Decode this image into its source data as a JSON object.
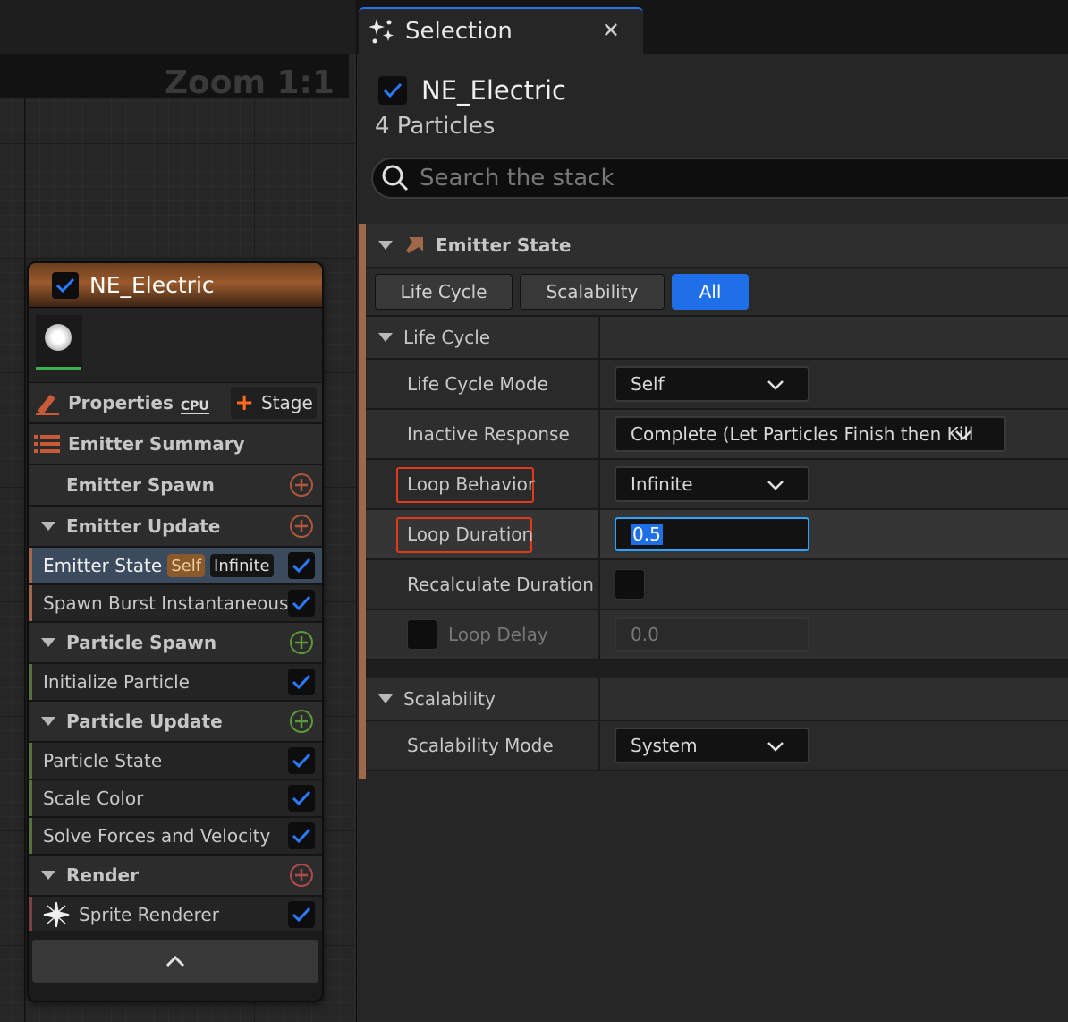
{
  "graph": {
    "zoom_label": "Zoom 1:1"
  },
  "node": {
    "title": "NE_Electric",
    "title_checked": true,
    "properties_label": "Properties",
    "cpu_badge": "CPU",
    "stage_button": "Stage",
    "rows": [
      {
        "kind": "head",
        "label": "Emitter Summary",
        "icon": "list-icon"
      },
      {
        "kind": "subhead",
        "label": "Emitter Spawn",
        "add": "orange"
      },
      {
        "kind": "group",
        "label": "Emitter Update",
        "add": "orange"
      },
      {
        "kind": "item",
        "label": "Emitter State",
        "accent": "orange",
        "selected": true,
        "pills": [
          "Self",
          "Infinite"
        ],
        "checked": true
      },
      {
        "kind": "item",
        "label": "Spawn Burst Instantaneous",
        "accent": "orange",
        "checked": true
      },
      {
        "kind": "group",
        "label": "Particle Spawn",
        "add": "green"
      },
      {
        "kind": "item",
        "label": "Initialize Particle",
        "accent": "green",
        "checked": true
      },
      {
        "kind": "group",
        "label": "Particle Update",
        "add": "green"
      },
      {
        "kind": "item",
        "label": "Particle State",
        "accent": "green",
        "checked": true
      },
      {
        "kind": "item",
        "label": "Scale Color",
        "accent": "green",
        "checked": true
      },
      {
        "kind": "item",
        "label": "Solve Forces and Velocity",
        "accent": "green",
        "checked": true
      },
      {
        "kind": "group",
        "label": "Render",
        "add": "red"
      },
      {
        "kind": "item",
        "label": "Sprite Renderer",
        "accent": "red",
        "checked": true,
        "icon": "sprite-icon"
      }
    ]
  },
  "panel": {
    "tab_title": "Selection",
    "emitter_name": "NE_Electric",
    "particles_count": "4 Particles",
    "search_placeholder": "Search the stack",
    "section_title": "Emitter State",
    "filters": [
      {
        "label": "Life Cycle",
        "active": false
      },
      {
        "label": "Scalability",
        "active": false
      },
      {
        "label": "All",
        "active": true
      }
    ],
    "lifecycle": {
      "category": "Life Cycle",
      "life_cycle_mode": {
        "label": "Life Cycle Mode",
        "value": "Self"
      },
      "inactive_response": {
        "label": "Inactive Response",
        "value": "Complete (Let Particles Finish then Kill"
      },
      "loop_behavior": {
        "label": "Loop Behavior",
        "value": "Infinite"
      },
      "loop_duration": {
        "label": "Loop Duration",
        "value": "0.5"
      },
      "recalc_duration": {
        "label": "Recalculate Duration E"
      },
      "loop_delay": {
        "label": "Loop Delay",
        "value": "0.0"
      }
    },
    "scalability": {
      "category": "Scalability",
      "mode": {
        "label": "Scalability Mode",
        "value": "System"
      }
    }
  },
  "colors": {
    "accent_blue": "#1e6fe8",
    "highlight_red": "#e03a1a",
    "emitter_orange": "#a0684a",
    "particle_green": "#58713e",
    "render_red": "#7a4242"
  }
}
